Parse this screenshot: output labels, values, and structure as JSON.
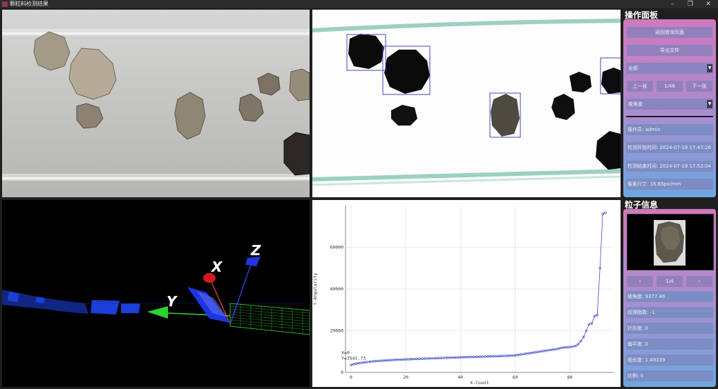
{
  "window": {
    "title": "颗粒料检测结果",
    "minimize": "–",
    "restore": "❐",
    "close": "✕"
  },
  "chart_data": {
    "type": "line",
    "xlabel": "X-Count",
    "ylabel": "Y-Angularity",
    "xlim": [
      -2,
      96
    ],
    "ylim": [
      0,
      80000
    ],
    "xticks": [
      0,
      20,
      40,
      60,
      80
    ],
    "yticks": [
      0,
      20000,
      40000,
      60000
    ],
    "grid": true,
    "readout": {
      "x_label": "X=0",
      "y_label": "Y=3541.73"
    },
    "color": "#3f4bc9",
    "series": [
      {
        "name": "",
        "x": [
          0,
          1,
          2,
          3,
          4,
          5,
          6,
          7,
          8,
          9,
          10,
          11,
          12,
          13,
          14,
          15,
          16,
          17,
          18,
          19,
          20,
          21,
          22,
          23,
          24,
          25,
          26,
          27,
          28,
          29,
          30,
          31,
          32,
          33,
          34,
          35,
          36,
          37,
          38,
          39,
          40,
          41,
          42,
          43,
          44,
          45,
          46,
          47,
          48,
          49,
          50,
          51,
          52,
          53,
          54,
          55,
          56,
          57,
          58,
          59,
          60,
          61,
          62,
          63,
          64,
          65,
          66,
          67,
          68,
          69,
          70,
          71,
          72,
          73,
          74,
          75,
          76,
          77,
          78,
          79,
          80,
          81,
          82,
          83,
          84,
          85,
          86,
          87,
          88,
          89,
          90,
          91,
          92,
          93
        ],
        "y": [
          3542,
          4000,
          4250,
          4450,
          4650,
          4850,
          5000,
          5150,
          5300,
          5420,
          5520,
          5620,
          5720,
          5800,
          5880,
          5950,
          6020,
          6080,
          6140,
          6200,
          6260,
          6320,
          6380,
          6430,
          6480,
          6530,
          6580,
          6630,
          6680,
          6730,
          6780,
          6830,
          6880,
          6930,
          6980,
          7030,
          7080,
          7130,
          7180,
          7220,
          7260,
          7300,
          7340,
          7380,
          7420,
          7460,
          7500,
          7540,
          7580,
          7620,
          7660,
          7700,
          7740,
          7780,
          7830,
          7880,
          7930,
          7980,
          8040,
          8100,
          8200,
          8400,
          8600,
          8800,
          9000,
          9200,
          9400,
          9600,
          9800,
          10000,
          10200,
          10400,
          10600,
          10800,
          11000,
          11200,
          11500,
          11800,
          12000,
          12100,
          12200,
          12400,
          12700,
          13500,
          15000,
          17000,
          20000,
          23000,
          23500,
          27000,
          27500,
          50000,
          76000,
          76500
        ]
      }
    ]
  },
  "panel_ops": {
    "title": "操作面板",
    "back_button": "返回查询页面",
    "export_button": "导出文件",
    "filter_select": "全部",
    "prev_button": "上一张",
    "page_indicator": "1/46",
    "next_button": "下一张",
    "metric_select": "棱角度",
    "operator": "操作员: admin",
    "start_time": "检测开始时间: 2024-07-18 17:47:26",
    "end_time": "检测结束时间: 2024-07-18 17:52:04",
    "pixel_size": "像素尺寸: 16.65px/mm"
  },
  "panel_particle": {
    "title": "粒子信息",
    "prev": "‹",
    "indicator": "1/4",
    "next": "›",
    "angularity": "棱角度: 9377.46",
    "texture": "纹理指数: -1",
    "needle": "针形度: 0",
    "flatness": "偏平度: 0",
    "elongation": "细长度: 1.49339",
    "ratio": "比例: 0"
  },
  "axis3d": {
    "x_label": "X",
    "y_label": "Y",
    "z_label": "Z"
  }
}
